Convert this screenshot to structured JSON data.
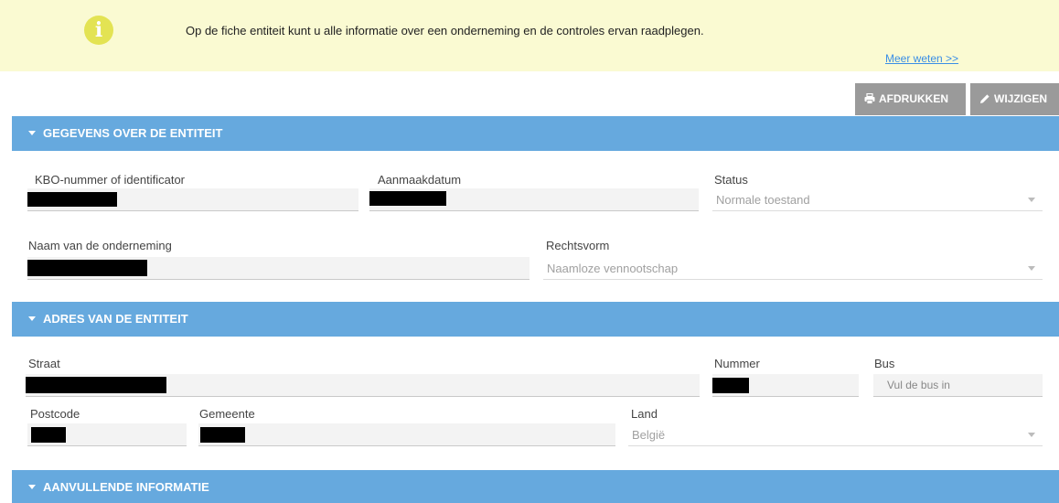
{
  "info": {
    "icon": "info-icon",
    "message": "Op de fiche entiteit kunt u alle informatie over een onderneming en de controles ervan raadplegen.",
    "link": "Meer weten >>"
  },
  "actions": {
    "print_label": "AFDRUKKEN",
    "edit_label": "WIJZIGEN"
  },
  "sections": {
    "entity": "GEGEVENS OVER DE ENTITEIT",
    "address": "ADRES VAN DE ENTITEIT",
    "extra": "AANVULLENDE INFORMATIE"
  },
  "entity": {
    "kbo_label": "KBO-nummer of identificator",
    "date_label": "Aanmaakdatum",
    "status_label": "Status",
    "status_value": "Normale toestand",
    "name_label": "Naam van de onderneming",
    "legal_form_label": "Rechtsvorm",
    "legal_form_value": "Naamloze vennootschap"
  },
  "address": {
    "street_label": "Straat",
    "number_label": "Nummer",
    "box_label": "Bus",
    "box_placeholder": "Vul de bus in",
    "postcode_label": "Postcode",
    "municipality_label": "Gemeente",
    "country_label": "Land",
    "country_value": "België"
  },
  "colors": {
    "banner": "#fafad2",
    "info_icon": "#e3e353",
    "section_header": "#66a9de",
    "action_button": "#9a9a9a",
    "link": "#3a8ee6"
  }
}
